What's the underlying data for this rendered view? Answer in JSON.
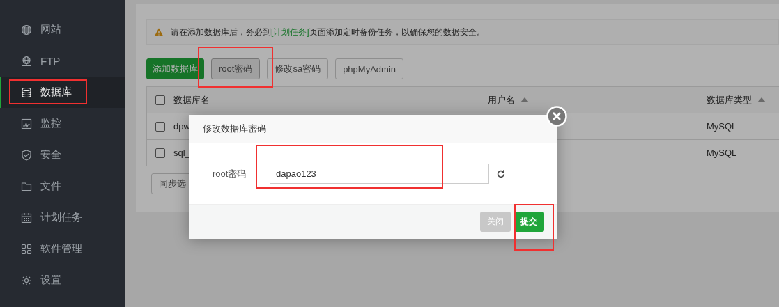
{
  "sidebar": {
    "items": [
      {
        "label": "网站",
        "selected": false
      },
      {
        "label": "FTP",
        "selected": false
      },
      {
        "label": "数据库",
        "selected": true
      },
      {
        "label": "监控",
        "selected": false
      },
      {
        "label": "安全",
        "selected": false
      },
      {
        "label": "文件",
        "selected": false
      },
      {
        "label": "计划任务",
        "selected": false
      },
      {
        "label": "软件管理",
        "selected": false
      },
      {
        "label": "设置",
        "selected": false
      }
    ]
  },
  "alert": {
    "before": "请在添加数据库后，务必到",
    "link": "[计划任务]",
    "after": "页面添加定时备份任务，以确保您的数据安全。"
  },
  "toolbar": [
    {
      "label": "添加数据库",
      "kind": "primary"
    },
    {
      "label": "root密码",
      "kind": "pressed"
    },
    {
      "label": "修改sa密码",
      "kind": "default"
    },
    {
      "label": "phpMyAdmin",
      "kind": "default"
    }
  ],
  "table": {
    "header_checked": false,
    "columns": [
      {
        "label": "数据库名",
        "sortable": false
      },
      {
        "label": "用户名",
        "sortable": true
      },
      {
        "label": "数据库类型",
        "sortable": true
      }
    ],
    "rows": [
      {
        "checked": false,
        "name": "dpw",
        "type": "MySQL"
      },
      {
        "checked": false,
        "name": "sql_",
        "type": "MySQL"
      }
    ]
  },
  "sync_button": "同步选",
  "dialog": {
    "title": "修改数据库密码",
    "label": "root密码",
    "value": "dapao123",
    "buttons": [
      {
        "label": "关闭",
        "kind": "muted"
      },
      {
        "label": "提交",
        "kind": "primary"
      }
    ]
  }
}
